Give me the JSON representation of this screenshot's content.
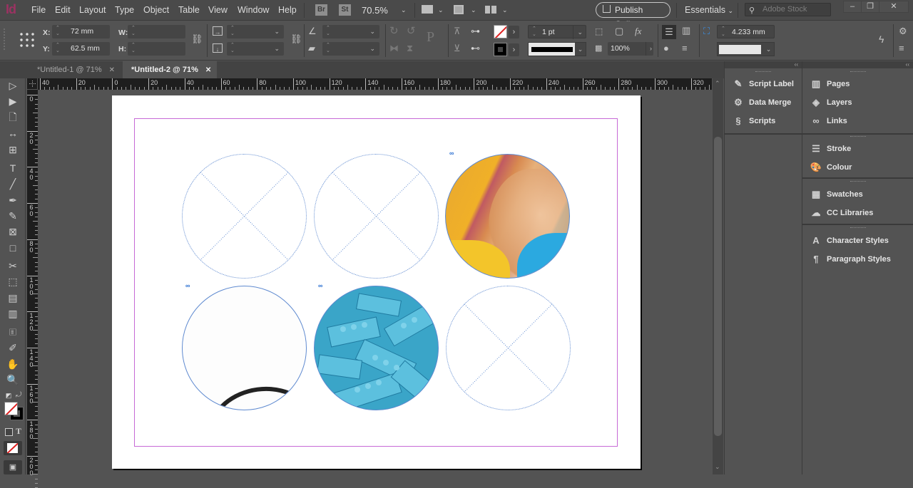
{
  "app": {
    "logo": "Id"
  },
  "menu": [
    "File",
    "Edit",
    "Layout",
    "Type",
    "Object",
    "Table",
    "View",
    "Window",
    "Help"
  ],
  "appbar": {
    "bridge_badge": "Br",
    "stock_badge": "St",
    "zoom": "70.5%",
    "publish_label": "Publish Online",
    "workspace": "Essentials",
    "search_placeholder": "Adobe Stock",
    "win_min": "–",
    "win_restore": "❐",
    "win_close": "✕"
  },
  "control": {
    "x_label": "X:",
    "x_value": "72 mm",
    "y_label": "Y:",
    "y_value": "62.5 mm",
    "w_label": "W:",
    "w_value": "",
    "h_label": "H:",
    "h_value": "",
    "stroke_weight": "1 pt",
    "opacity": "100%",
    "frame_offset": "4.233 mm"
  },
  "tabs": [
    {
      "label": "*Untitled-1 @ 71%",
      "active": false
    },
    {
      "label": "*Untitled-2 @ 71%",
      "active": true
    }
  ],
  "ruler": {
    "h_labels": [
      "40",
      "20",
      "0",
      "20",
      "40",
      "60",
      "80",
      "100",
      "120",
      "140",
      "160",
      "180",
      "200",
      "220",
      "240",
      "260",
      "280",
      "300",
      "320"
    ],
    "v_labels": [
      "0",
      "20",
      "40",
      "60",
      "80",
      "100",
      "120",
      "140",
      "160",
      "180",
      "200"
    ]
  },
  "tools": [
    {
      "name": "selection-tool",
      "glyph": "▷"
    },
    {
      "name": "direct-selection-tool",
      "glyph": "▶"
    },
    {
      "name": "page-tool",
      "glyph": "🗋"
    },
    {
      "name": "gap-tool",
      "glyph": "↔"
    },
    {
      "name": "content-collector-tool",
      "glyph": "⊞"
    },
    {
      "name": "type-tool",
      "glyph": "T"
    },
    {
      "name": "line-tool",
      "glyph": "╱"
    },
    {
      "name": "pen-tool",
      "glyph": "✒"
    },
    {
      "name": "pencil-tool",
      "glyph": "✎"
    },
    {
      "name": "rectangle-frame-tool",
      "glyph": "⊠"
    },
    {
      "name": "rectangle-tool",
      "glyph": "□"
    },
    {
      "name": "scissors-tool",
      "glyph": "✂"
    },
    {
      "name": "free-transform-tool",
      "glyph": "⬚"
    },
    {
      "name": "gradient-swatch-tool",
      "glyph": "▤"
    },
    {
      "name": "gradient-feather-tool",
      "glyph": "▥"
    },
    {
      "name": "note-tool",
      "glyph": "🗉"
    },
    {
      "name": "eyedropper-tool",
      "glyph": "✐"
    },
    {
      "name": "hand-tool",
      "glyph": "✋"
    },
    {
      "name": "zoom-tool",
      "glyph": "🔍"
    }
  ],
  "panels_left": [
    {
      "label": "Script Label",
      "icon": "script-label-icon",
      "glyph": "✎"
    },
    {
      "label": "Data Merge",
      "icon": "data-merge-icon",
      "glyph": "⚙"
    },
    {
      "label": "Scripts",
      "icon": "scripts-icon",
      "glyph": "§"
    }
  ],
  "panels_right": [
    {
      "label": "Pages",
      "icon": "pages-icon",
      "glyph": "▥"
    },
    {
      "label": "Layers",
      "icon": "layers-icon",
      "glyph": "◈"
    },
    {
      "label": "Links",
      "icon": "links-icon",
      "glyph": "∞"
    },
    {
      "label": "Stroke",
      "icon": "stroke-icon",
      "glyph": "☰"
    },
    {
      "label": "Colour",
      "icon": "colour-icon",
      "glyph": "🎨"
    },
    {
      "label": "Swatches",
      "icon": "swatches-icon",
      "glyph": "▦"
    },
    {
      "label": "CC Libraries",
      "icon": "cc-libraries-icon",
      "glyph": "☁"
    },
    {
      "label": "Character Styles",
      "icon": "character-styles-icon",
      "glyph": "A"
    },
    {
      "label": "Paragraph Styles",
      "icon": "paragraph-styles-icon",
      "glyph": "¶"
    }
  ],
  "colors": {
    "margin_guide": "#c76ad6",
    "frame_edge": "#5f8ad0",
    "link_icon": "#2a6fd1",
    "logo": "#9c3262"
  },
  "canvas": {
    "frames": [
      {
        "row": 1,
        "col": 1,
        "content": "empty"
      },
      {
        "row": 1,
        "col": 2,
        "content": "empty"
      },
      {
        "row": 1,
        "col": 3,
        "content": "image-hand-fist",
        "linked": true
      },
      {
        "row": 2,
        "col": 1,
        "content": "image-cable-mostly-white",
        "linked": true
      },
      {
        "row": 2,
        "col": 2,
        "content": "image-blue-lego-bricks",
        "linked": true
      },
      {
        "row": 2,
        "col": 3,
        "content": "empty"
      }
    ]
  }
}
